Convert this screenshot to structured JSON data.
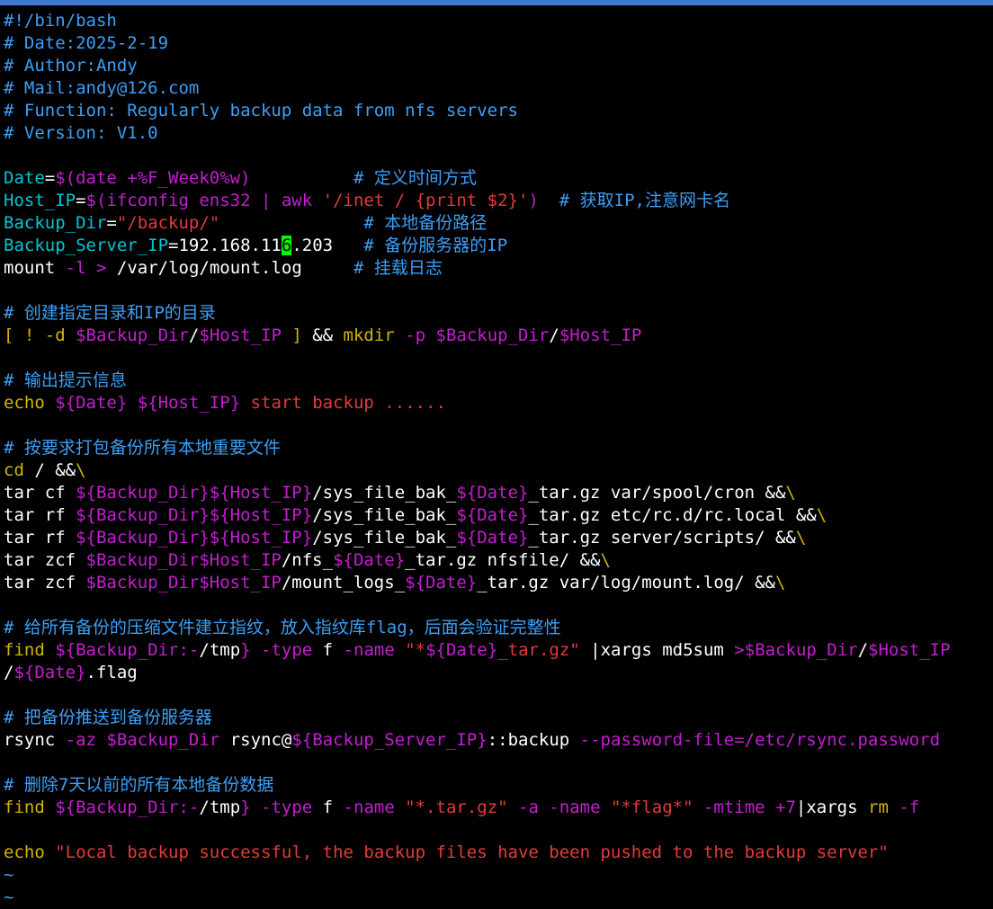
{
  "colors": {
    "background": "#000000",
    "default": "#ffffff",
    "comment": "#3d9ff5",
    "var": "#00c6d6",
    "ref": "#c41ed0",
    "str": "#e23b3b",
    "cmd": "#d2b400",
    "num": "#ffffff",
    "cursor_bg": "#00ff00",
    "topbar": "#3f78cf"
  },
  "editor": {
    "cursor": {
      "line": 13,
      "column": 28
    },
    "lines": [
      [
        [
          "comment",
          "#!/bin/bash"
        ]
      ],
      [
        [
          "comment",
          "# Date:2025-2-19"
        ]
      ],
      [
        [
          "comment",
          "# Author:Andy"
        ]
      ],
      [
        [
          "comment",
          "# Mail:andy@126.com"
        ]
      ],
      [
        [
          "comment",
          "# Function: Regularly backup data from nfs servers"
        ]
      ],
      [
        [
          "comment",
          "# Version: V1.0"
        ]
      ],
      [],
      [
        [
          "var",
          "Date"
        ],
        [
          "default",
          "="
        ],
        [
          "ref",
          "$(date +%F_Week0%w)"
        ],
        [
          "default",
          "          "
        ],
        [
          "comment",
          "# 定义时间方式"
        ]
      ],
      [
        [
          "var",
          "Host_IP"
        ],
        [
          "default",
          "="
        ],
        [
          "ref",
          "$(ifconfig ens32 | awk "
        ],
        [
          "str",
          "'/inet / {print $2}'"
        ],
        [
          "ref",
          ")"
        ],
        [
          "default",
          "  "
        ],
        [
          "comment",
          "# 获取IP,注意网卡名"
        ]
      ],
      [
        [
          "var",
          "Backup_Dir"
        ],
        [
          "default",
          "="
        ],
        [
          "str",
          "\"/backup/\""
        ],
        [
          "default",
          "              "
        ],
        [
          "comment",
          "# 本地备份路径"
        ]
      ],
      [
        [
          "var",
          "Backup_Server_IP"
        ],
        [
          "default",
          "=192.168.11"
        ],
        [
          "cursor",
          "6"
        ],
        [
          "default",
          ".203   "
        ],
        [
          "comment",
          "# 备份服务器的IP"
        ]
      ],
      [
        [
          "default",
          "mount "
        ],
        [
          "ref",
          "-l"
        ],
        [
          "default",
          " "
        ],
        [
          "ref",
          ">"
        ],
        [
          "default",
          " /var/log/mount.log     "
        ],
        [
          "comment",
          "# 挂载日志"
        ]
      ],
      [],
      [
        [
          "comment",
          "# 创建指定目录和IP的目录"
        ]
      ],
      [
        [
          "cmd",
          "[ ! -d "
        ],
        [
          "ref",
          "$Backup_Dir"
        ],
        [
          "default",
          "/"
        ],
        [
          "ref",
          "$Host_IP"
        ],
        [
          "cmd",
          " ]"
        ],
        [
          "default",
          " && "
        ],
        [
          "cmd",
          "mkdir"
        ],
        [
          "ref",
          " -p "
        ],
        [
          "ref",
          "$Backup_Dir"
        ],
        [
          "default",
          "/"
        ],
        [
          "ref",
          "$Host_IP"
        ]
      ],
      [],
      [
        [
          "comment",
          "# 输出提示信息"
        ]
      ],
      [
        [
          "cmd",
          "echo"
        ],
        [
          "default",
          " "
        ],
        [
          "ref",
          "${Date}"
        ],
        [
          "default",
          " "
        ],
        [
          "ref",
          "${Host_IP}"
        ],
        [
          "str",
          " start backup ......"
        ]
      ],
      [],
      [
        [
          "comment",
          "# 按要求打包备份所有本地重要文件"
        ]
      ],
      [
        [
          "cmd",
          "cd"
        ],
        [
          "default",
          " / &&"
        ],
        [
          "cmd",
          "\\"
        ]
      ],
      [
        [
          "default",
          "tar cf "
        ],
        [
          "ref",
          "${Backup_Dir}${Host_IP}"
        ],
        [
          "default",
          "/sys_file_bak_"
        ],
        [
          "ref",
          "${Date}"
        ],
        [
          "default",
          "_tar.gz var/spool/cron &&"
        ],
        [
          "cmd",
          "\\"
        ]
      ],
      [
        [
          "default",
          "tar rf "
        ],
        [
          "ref",
          "${Backup_Dir}${Host_IP}"
        ],
        [
          "default",
          "/sys_file_bak_"
        ],
        [
          "ref",
          "${Date}"
        ],
        [
          "default",
          "_tar.gz etc/rc.d/rc.local &&"
        ],
        [
          "cmd",
          "\\"
        ]
      ],
      [
        [
          "default",
          "tar rf "
        ],
        [
          "ref",
          "${Backup_Dir}${Host_IP}"
        ],
        [
          "default",
          "/sys_file_bak_"
        ],
        [
          "ref",
          "${Date}"
        ],
        [
          "default",
          "_tar.gz server/scripts/ &&"
        ],
        [
          "cmd",
          "\\"
        ]
      ],
      [
        [
          "default",
          "tar zcf "
        ],
        [
          "ref",
          "$Backup_Dir$Host_IP"
        ],
        [
          "default",
          "/nfs_"
        ],
        [
          "ref",
          "${Date}"
        ],
        [
          "default",
          "_tar.gz nfsfile/ &&"
        ],
        [
          "cmd",
          "\\"
        ]
      ],
      [
        [
          "default",
          "tar zcf "
        ],
        [
          "ref",
          "$Backup_Dir$Host_IP"
        ],
        [
          "default",
          "/mount_logs_"
        ],
        [
          "ref",
          "${Date}"
        ],
        [
          "default",
          "_tar.gz var/log/mount.log/ &&"
        ],
        [
          "cmd",
          "\\"
        ]
      ],
      [],
      [
        [
          "comment",
          "# 给所有备份的压缩文件建立指纹，放入指纹库flag，后面会验证完整性"
        ]
      ],
      [
        [
          "cmd",
          "find"
        ],
        [
          "default",
          " "
        ],
        [
          "ref",
          "${Backup_Dir:-"
        ],
        [
          "default",
          "/tmp"
        ],
        [
          "ref",
          "}"
        ],
        [
          "ref",
          " -type"
        ],
        [
          "default",
          " f "
        ],
        [
          "ref",
          "-name"
        ],
        [
          "default",
          " "
        ],
        [
          "str",
          "\"*"
        ],
        [
          "ref",
          "${Date}"
        ],
        [
          "str",
          "_tar.gz\""
        ],
        [
          "default",
          " |xargs md5sum "
        ],
        [
          "ref",
          ">"
        ],
        [
          "ref",
          "$Backup_Dir"
        ],
        [
          "default",
          "/"
        ],
        [
          "ref",
          "$Host_IP"
        ]
      ],
      [
        [
          "default",
          "/"
        ],
        [
          "ref",
          "${Date}"
        ],
        [
          "default",
          ".flag"
        ]
      ],
      [],
      [
        [
          "comment",
          "# 把备份推送到备份服务器"
        ]
      ],
      [
        [
          "default",
          "rsync "
        ],
        [
          "ref",
          "-az"
        ],
        [
          "default",
          " "
        ],
        [
          "ref",
          "$Backup_Dir"
        ],
        [
          "default",
          " rsync@"
        ],
        [
          "ref",
          "${Backup_Server_IP}"
        ],
        [
          "default",
          "::backup "
        ],
        [
          "ref",
          "--password-file=/etc/rsync.password"
        ]
      ],
      [],
      [
        [
          "comment",
          "# 删除7天以前的所有本地备份数据"
        ]
      ],
      [
        [
          "cmd",
          "find"
        ],
        [
          "default",
          " "
        ],
        [
          "ref",
          "${Backup_Dir:-"
        ],
        [
          "default",
          "/tmp"
        ],
        [
          "ref",
          "}"
        ],
        [
          "ref",
          " -type"
        ],
        [
          "default",
          " f "
        ],
        [
          "ref",
          "-name"
        ],
        [
          "default",
          " "
        ],
        [
          "str",
          "\"*.tar.gz\""
        ],
        [
          "ref",
          " -a -name"
        ],
        [
          "default",
          " "
        ],
        [
          "str",
          "\"*flag*\""
        ],
        [
          "ref",
          " -mtime +7"
        ],
        [
          "default",
          "|xargs "
        ],
        [
          "cmd",
          "rm"
        ],
        [
          "ref",
          " -f"
        ]
      ],
      [],
      [
        [
          "cmd",
          "echo"
        ],
        [
          "default",
          " "
        ],
        [
          "str",
          "\"Local backup successful, the backup files have been pushed to the backup server\""
        ]
      ],
      [
        [
          "comment",
          "~"
        ]
      ],
      [
        [
          "comment",
          "~"
        ]
      ]
    ]
  }
}
